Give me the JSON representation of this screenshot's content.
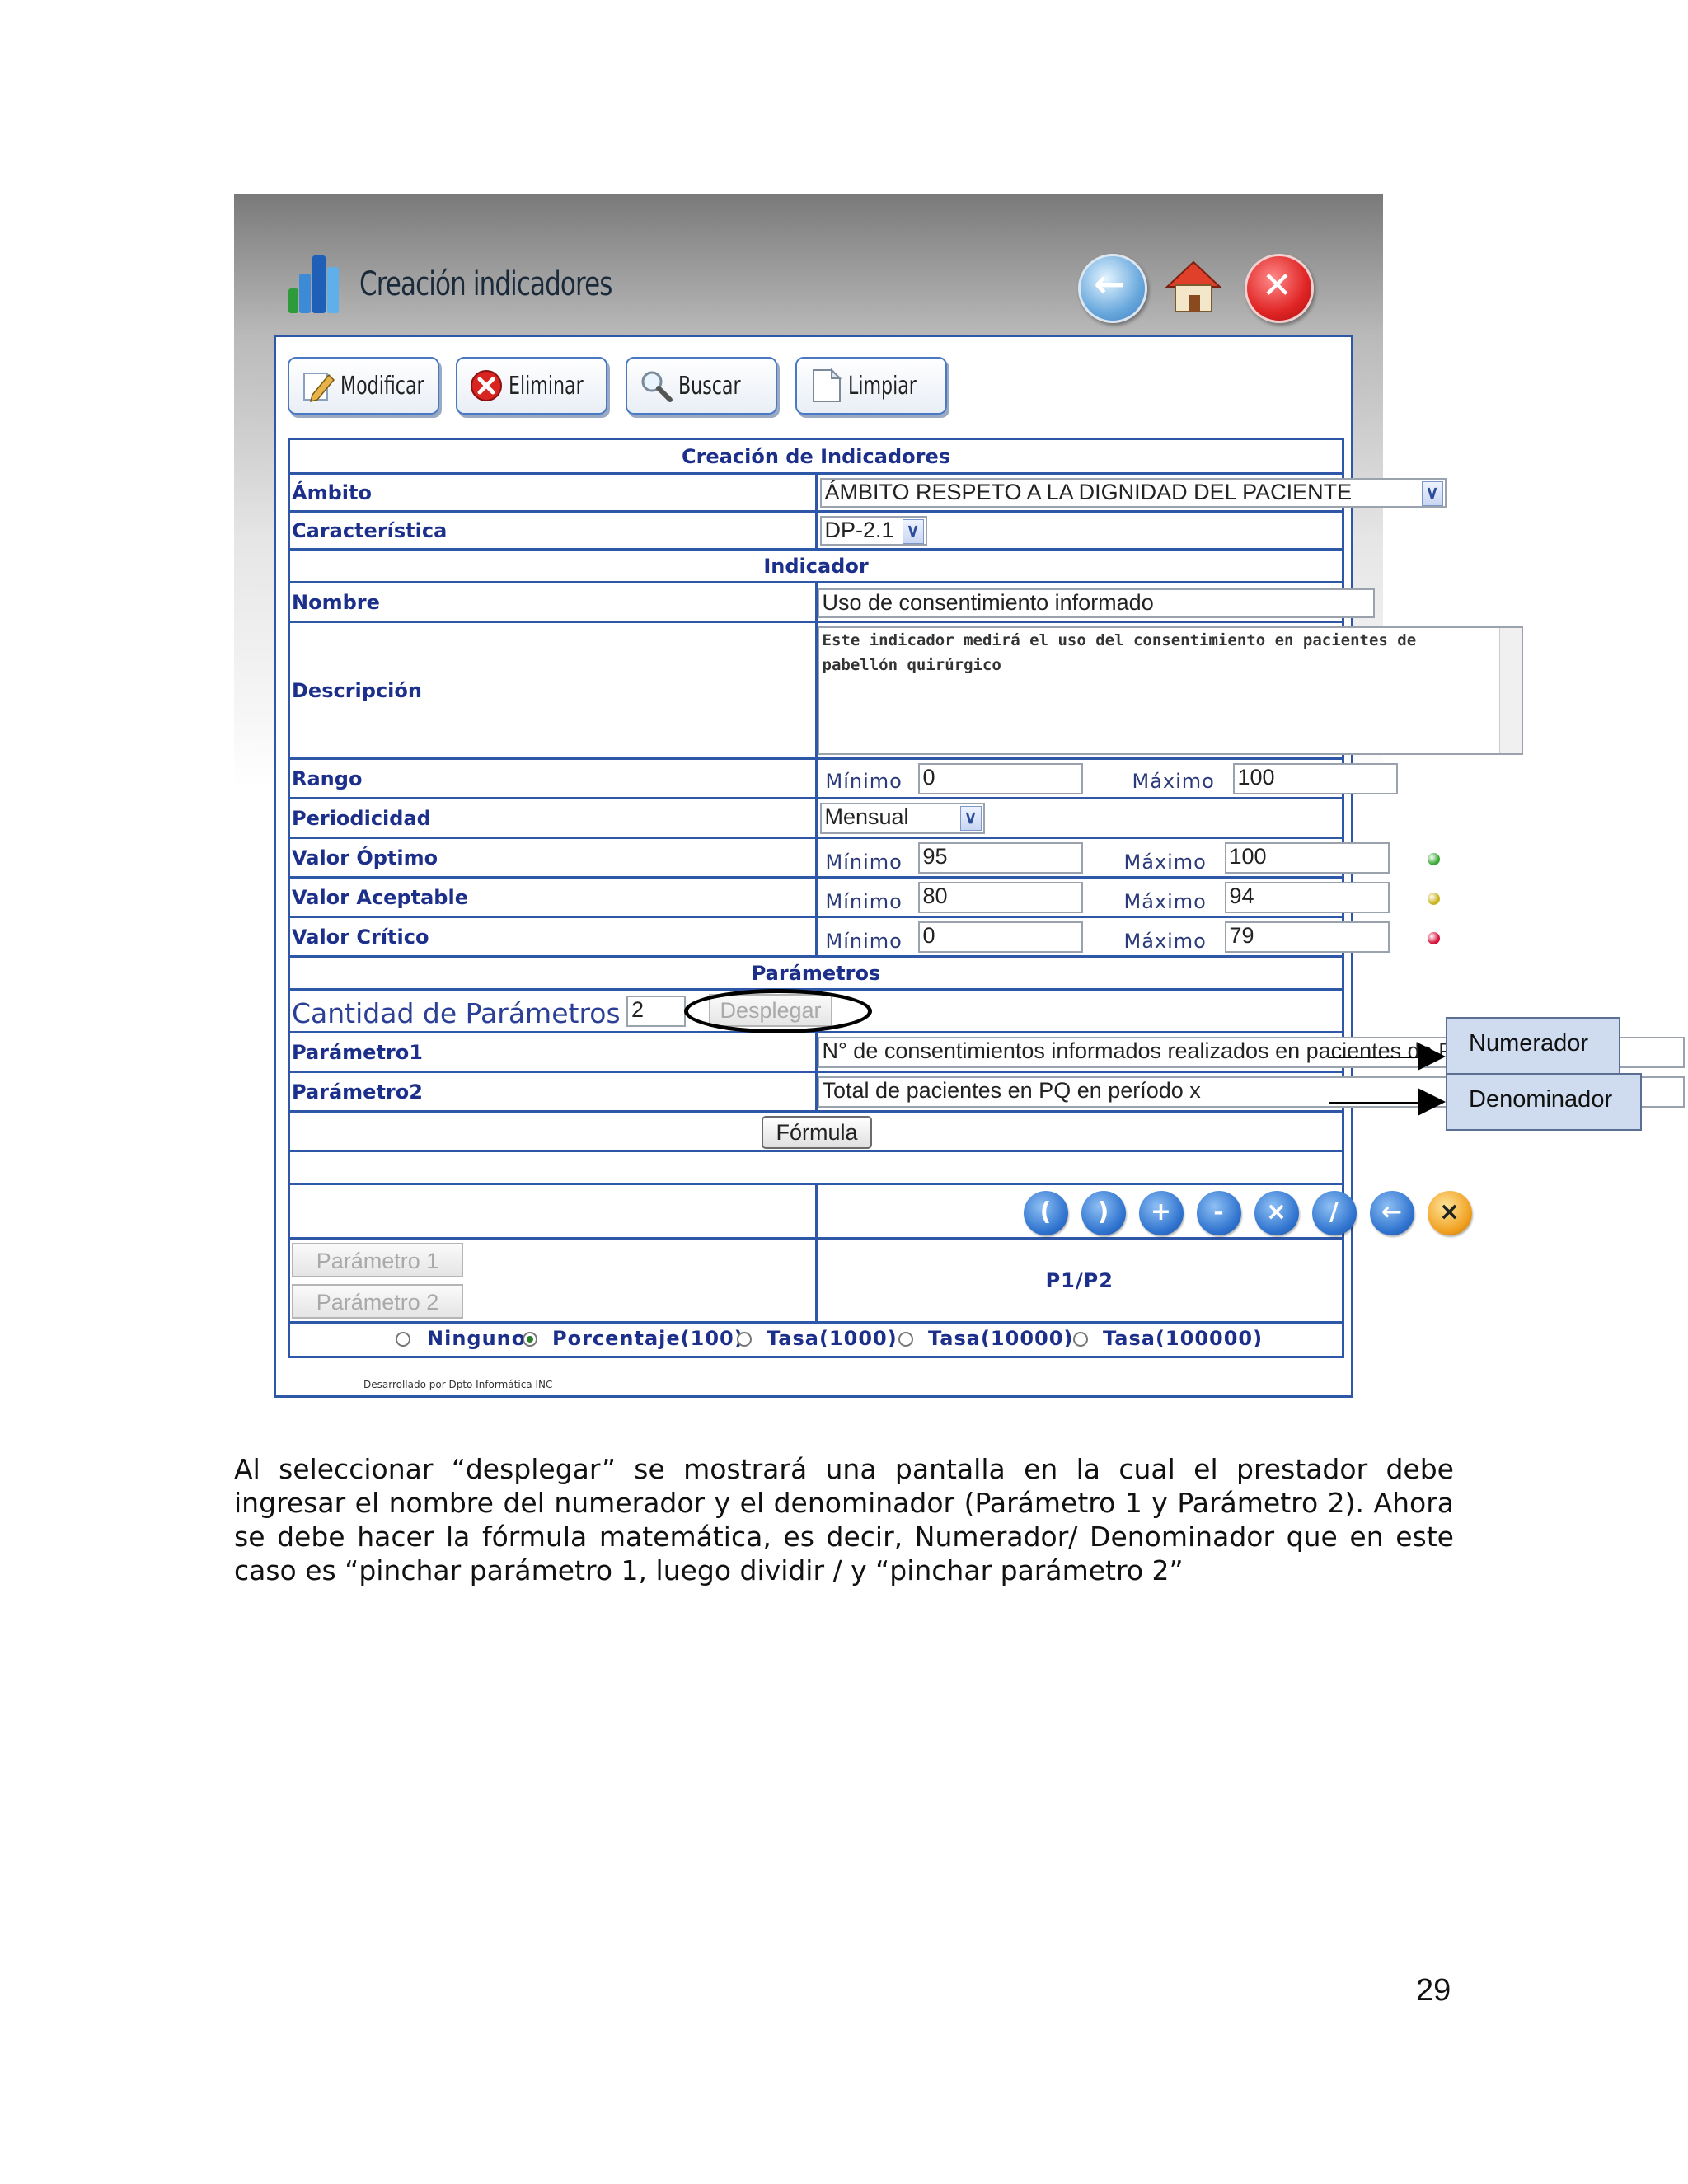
{
  "window": {
    "title": "Creación indicadores"
  },
  "toolbar": {
    "modificar": "Modificar",
    "eliminar": "Eliminar",
    "buscar": "Buscar",
    "limpiar": "Limpiar"
  },
  "form": {
    "title": "Creación de Indicadores",
    "ambito": {
      "label": "Ámbito",
      "value": "ÁMBITO RESPETO A LA DIGNIDAD DEL PACIENTE"
    },
    "caracteristica": {
      "label": "Característica",
      "value": "DP-2.1"
    },
    "indicador_section": "Indicador",
    "nombre": {
      "label": "Nombre",
      "value": "Uso de consentimiento informado"
    },
    "descripcion": {
      "label": "Descripción",
      "value": "Este indicador medirá el uso del consentimiento en pacientes de pabellón quirúrgico"
    },
    "minimo_label": "Mínimo",
    "maximo_label": "Máximo",
    "rango": {
      "label": "Rango",
      "min": "0",
      "max": "100"
    },
    "periodicidad": {
      "label": "Periodicidad",
      "value": "Mensual"
    },
    "optimo": {
      "label": "Valor Óptimo",
      "min": "95",
      "max": "100",
      "color": "#3aa935"
    },
    "aceptable": {
      "label": "Valor Aceptable",
      "min": "80",
      "max": "94",
      "color": "#c9b21e"
    },
    "critico": {
      "label": "Valor Crítico",
      "min": "0",
      "max": "79",
      "color": "#d8123a"
    },
    "parametros_section": "Parámetros",
    "cantidad": {
      "label": "Cantidad de Parámetros",
      "value": "2",
      "button": "Desplegar"
    },
    "parametro1": {
      "label": "Parámetro1",
      "value": "N° de consentimientos informados realizados en pacientes de PQ en período x"
    },
    "parametro2": {
      "label": "Parámetro2",
      "value": "Total de pacientes en PQ en período x"
    },
    "formula_button": "Fórmula",
    "operators": [
      "(",
      ")",
      "+",
      "-",
      "×",
      "/",
      "←",
      "×"
    ],
    "param1_button": "Parámetro 1",
    "param2_button": "Parámetro 2",
    "formula_result": "P1/P2",
    "radios": [
      {
        "label": "Ninguno",
        "selected": false
      },
      {
        "label": "Porcentaje(100)",
        "selected": true
      },
      {
        "label": "Tasa(1000)",
        "selected": false
      },
      {
        "label": "Tasa(10000)",
        "selected": false
      },
      {
        "label": "Tasa(100000)",
        "selected": false
      }
    ],
    "footer": "Desarrollado por Dpto Informática INC"
  },
  "callouts": {
    "numerador": "Numerador",
    "denominador": "Denominador"
  },
  "body_text": "Al seleccionar “desplegar” se mostrará una pantalla en la cual el prestador debe ingresar el nombre del numerador y el denominador (Parámetro 1 y Parámetro 2). Ahora se debe hacer la fórmula matemática, es decir, Numerador/ Denominador que en este caso es “pinchar parámetro 1, luego dividir / y “pinchar parámetro 2”",
  "page_number": "29"
}
